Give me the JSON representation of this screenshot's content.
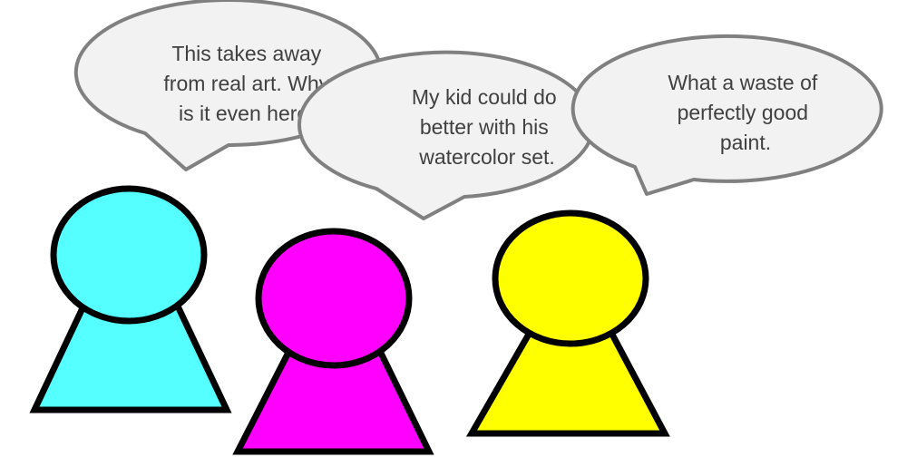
{
  "colors": {
    "bubble_fill": "#f2f2f2",
    "bubble_stroke": "#808080",
    "text": "#404040",
    "figure_outline": "#000000",
    "figure_1": "#55ffff",
    "figure_2": "#ff00ff",
    "figure_3": "#ffff00"
  },
  "speech_bubbles": [
    {
      "lines": [
        "This takes away",
        "from real art. Why",
        "is it even here?"
      ]
    },
    {
      "lines": [
        "My kid could do",
        "better with his",
        "watercolor set."
      ]
    },
    {
      "lines": [
        "What a waste of",
        "perfectly good",
        "paint."
      ]
    }
  ],
  "figures": [
    {
      "color_name": "cyan"
    },
    {
      "color_name": "magenta"
    },
    {
      "color_name": "yellow"
    }
  ]
}
